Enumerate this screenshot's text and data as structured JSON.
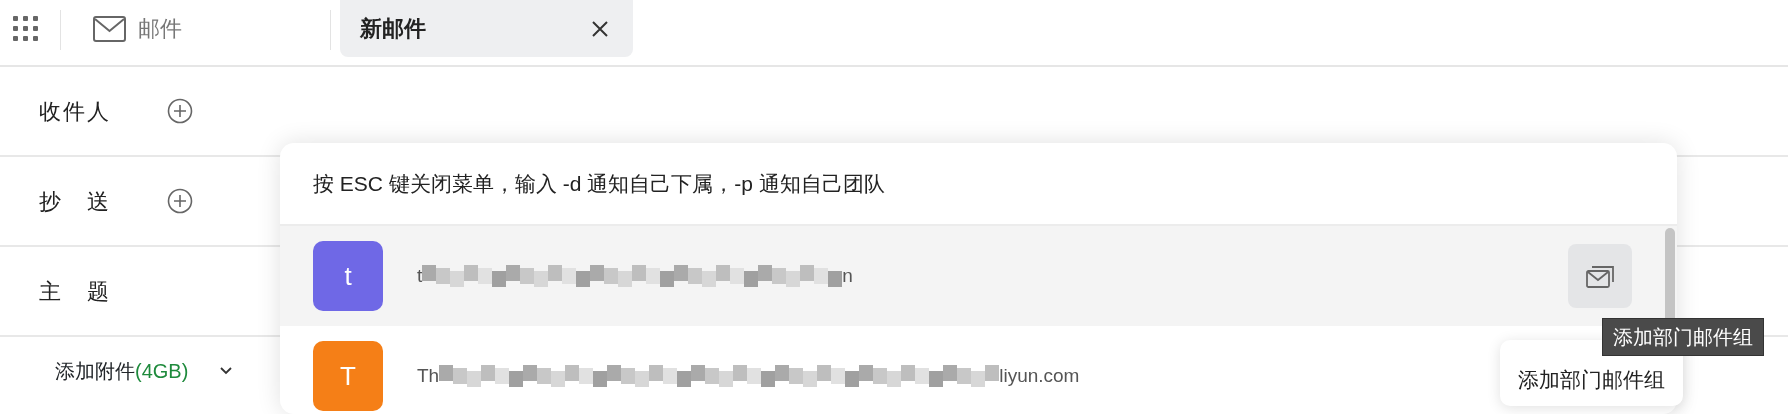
{
  "app_bar": {
    "tabs": [
      {
        "label": "邮件",
        "kind": "app",
        "selected": false
      },
      {
        "label": "新邮件",
        "kind": "document",
        "selected": true
      }
    ]
  },
  "fields": [
    {
      "label": "收件人",
      "add_button": true
    },
    {
      "label": "抄 送",
      "add_button": true
    },
    {
      "label": "主 题",
      "add_button": false
    }
  ],
  "attachment": {
    "label": "添加附件",
    "quota": "(4GB)"
  },
  "suggestions": {
    "hint": "按 ESC 键关闭菜单，输入 -d 通知自己下属，-p 通知自己团队",
    "items": [
      {
        "initial": "t",
        "color": "#6f68e6",
        "email_start": "t",
        "email_end": "n",
        "selected": true
      },
      {
        "initial": "T",
        "color": "#f57f17",
        "email_start": "Th",
        "email_end": "liyun.com",
        "selected": false
      }
    ]
  },
  "hover_tooltip": "添加部门邮件组",
  "bubble_tooltip": "添加部门邮件组"
}
